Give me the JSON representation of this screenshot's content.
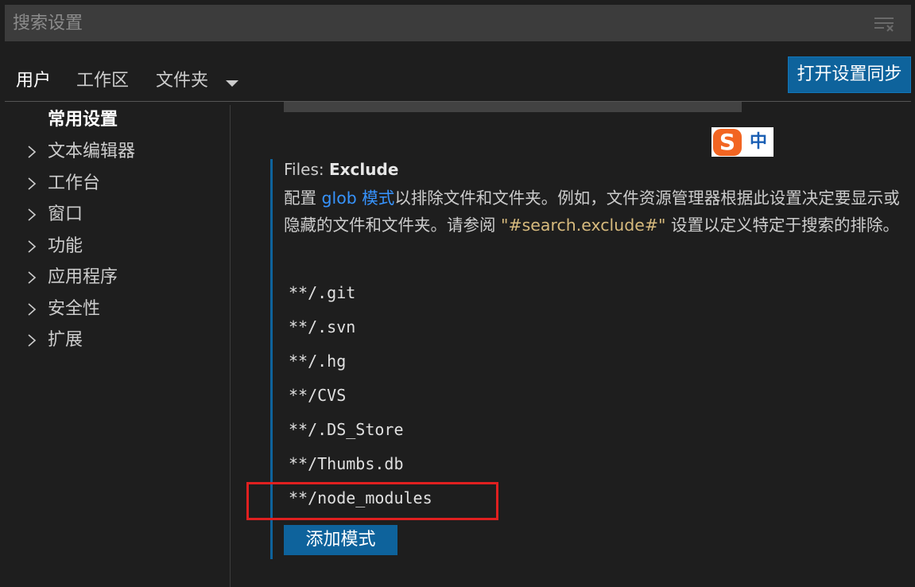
{
  "search": {
    "placeholder": "搜索设置"
  },
  "tabs": [
    {
      "label": "用户",
      "active": true
    },
    {
      "label": "工作区",
      "active": false
    },
    {
      "label": "文件夹",
      "active": false
    }
  ],
  "sync_button": {
    "label": "打开设置同步"
  },
  "toc": {
    "items": [
      {
        "label": "常用设置",
        "selected": true,
        "expandable": false
      },
      {
        "label": "文本编辑器",
        "selected": false,
        "expandable": true
      },
      {
        "label": "工作台",
        "selected": false,
        "expandable": true
      },
      {
        "label": "窗口",
        "selected": false,
        "expandable": true
      },
      {
        "label": "功能",
        "selected": false,
        "expandable": true
      },
      {
        "label": "应用程序",
        "selected": false,
        "expandable": true
      },
      {
        "label": "安全性",
        "selected": false,
        "expandable": true
      },
      {
        "label": "扩展",
        "selected": false,
        "expandable": true
      }
    ]
  },
  "ime": {
    "logo": "S",
    "mode": "中"
  },
  "setting": {
    "category": "Files: ",
    "name": "Exclude",
    "description": {
      "part1": "配置 ",
      "link": "glob 模式",
      "part2": "以排除文件和文件夹。例如，文件资源管理器根据此设置决定要显示或隐藏的文件和文件夹。请参阅 ",
      "code": "\"#search.exclude#\"",
      "part3": " 设置以定义特定于搜索的排除。"
    },
    "patterns": [
      "**/.git",
      "**/.svn",
      "**/.hg",
      "**/CVS",
      "**/.DS_Store",
      "**/Thumbs.db",
      "**/node_modules"
    ],
    "add_button_label": "添加模式"
  },
  "colors": {
    "background": "#1e1e1e",
    "accent": "#0e639c",
    "link": "#3794ff",
    "highlight": "#e02020"
  }
}
